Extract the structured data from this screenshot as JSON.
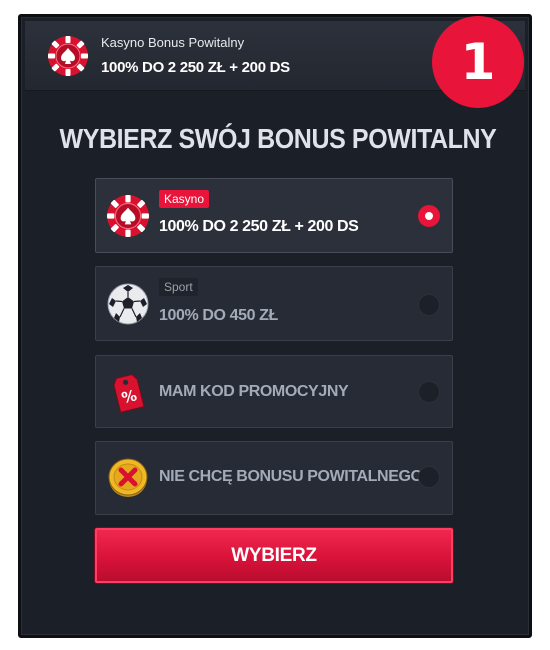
{
  "topbar": {
    "subtitle": "Kasyno Bonus Powitalny",
    "offer": "100% DO 2 250 ZŁ + 200 DS",
    "icon": "casino-chip-icon"
  },
  "step_badge": "1",
  "heading": "WYBIERZ SWÓJ BONUS POWITALNY",
  "options": [
    {
      "tag": "Kasyno",
      "label": "100% DO 2 250 ZŁ + 200 DS",
      "icon": "casino-chip-icon",
      "selected": true
    },
    {
      "tag": "Sport",
      "label": "100% DO 450 ZŁ",
      "icon": "soccer-ball-icon",
      "selected": false
    },
    {
      "tag": "",
      "label": "MAM KOD PROMOCYJNY",
      "icon": "promo-tag-icon",
      "selected": false
    },
    {
      "tag": "",
      "label": "NIE CHCĘ BONUSU POWITALNEGO",
      "icon": "no-bonus-coin-icon",
      "selected": false
    }
  ],
  "cta_label": "WYBIERZ",
  "colors": {
    "accent": "#e8143a",
    "panel": "#1b1f27",
    "option_bg": "#262b35"
  }
}
